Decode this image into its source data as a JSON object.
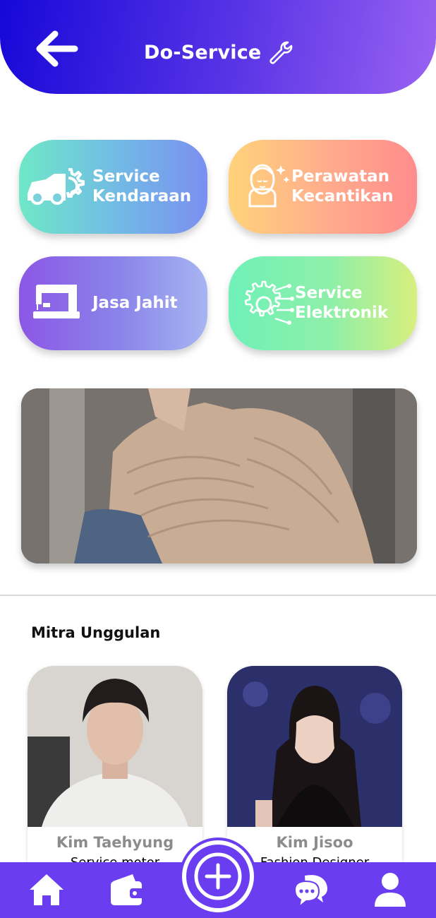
{
  "header": {
    "title": "Do-Service",
    "back_icon": "arrow-left-icon",
    "title_icon": "wrench-icon",
    "gradient": [
      "#1608d8",
      "#9a62f2"
    ]
  },
  "categories": [
    {
      "label": "Service\nKendaraan",
      "icon": "car-gear-icon"
    },
    {
      "label": "Perawatan\nKecantikan",
      "icon": "beauty-face-icon"
    },
    {
      "label": "Jasa Jahit",
      "icon": "sewing-machine-icon"
    },
    {
      "label": "Service\nElektronik",
      "icon": "circuit-gear-icon"
    }
  ],
  "banner": {
    "image": "knit-sweater-photo"
  },
  "featured": {
    "title": "Mitra Unggulan",
    "partners": [
      {
        "name": "Kim Taehyung",
        "role": "Service motor",
        "photo": "partner-photo"
      },
      {
        "name": "Kim Jisoo",
        "role": "Fashion Designer",
        "photo": "partner-photo"
      }
    ]
  },
  "nav": {
    "items": [
      "home-icon",
      "wallet-icon",
      "add-icon",
      "chat-icon",
      "profile-icon"
    ],
    "color": "#6a3df0"
  }
}
